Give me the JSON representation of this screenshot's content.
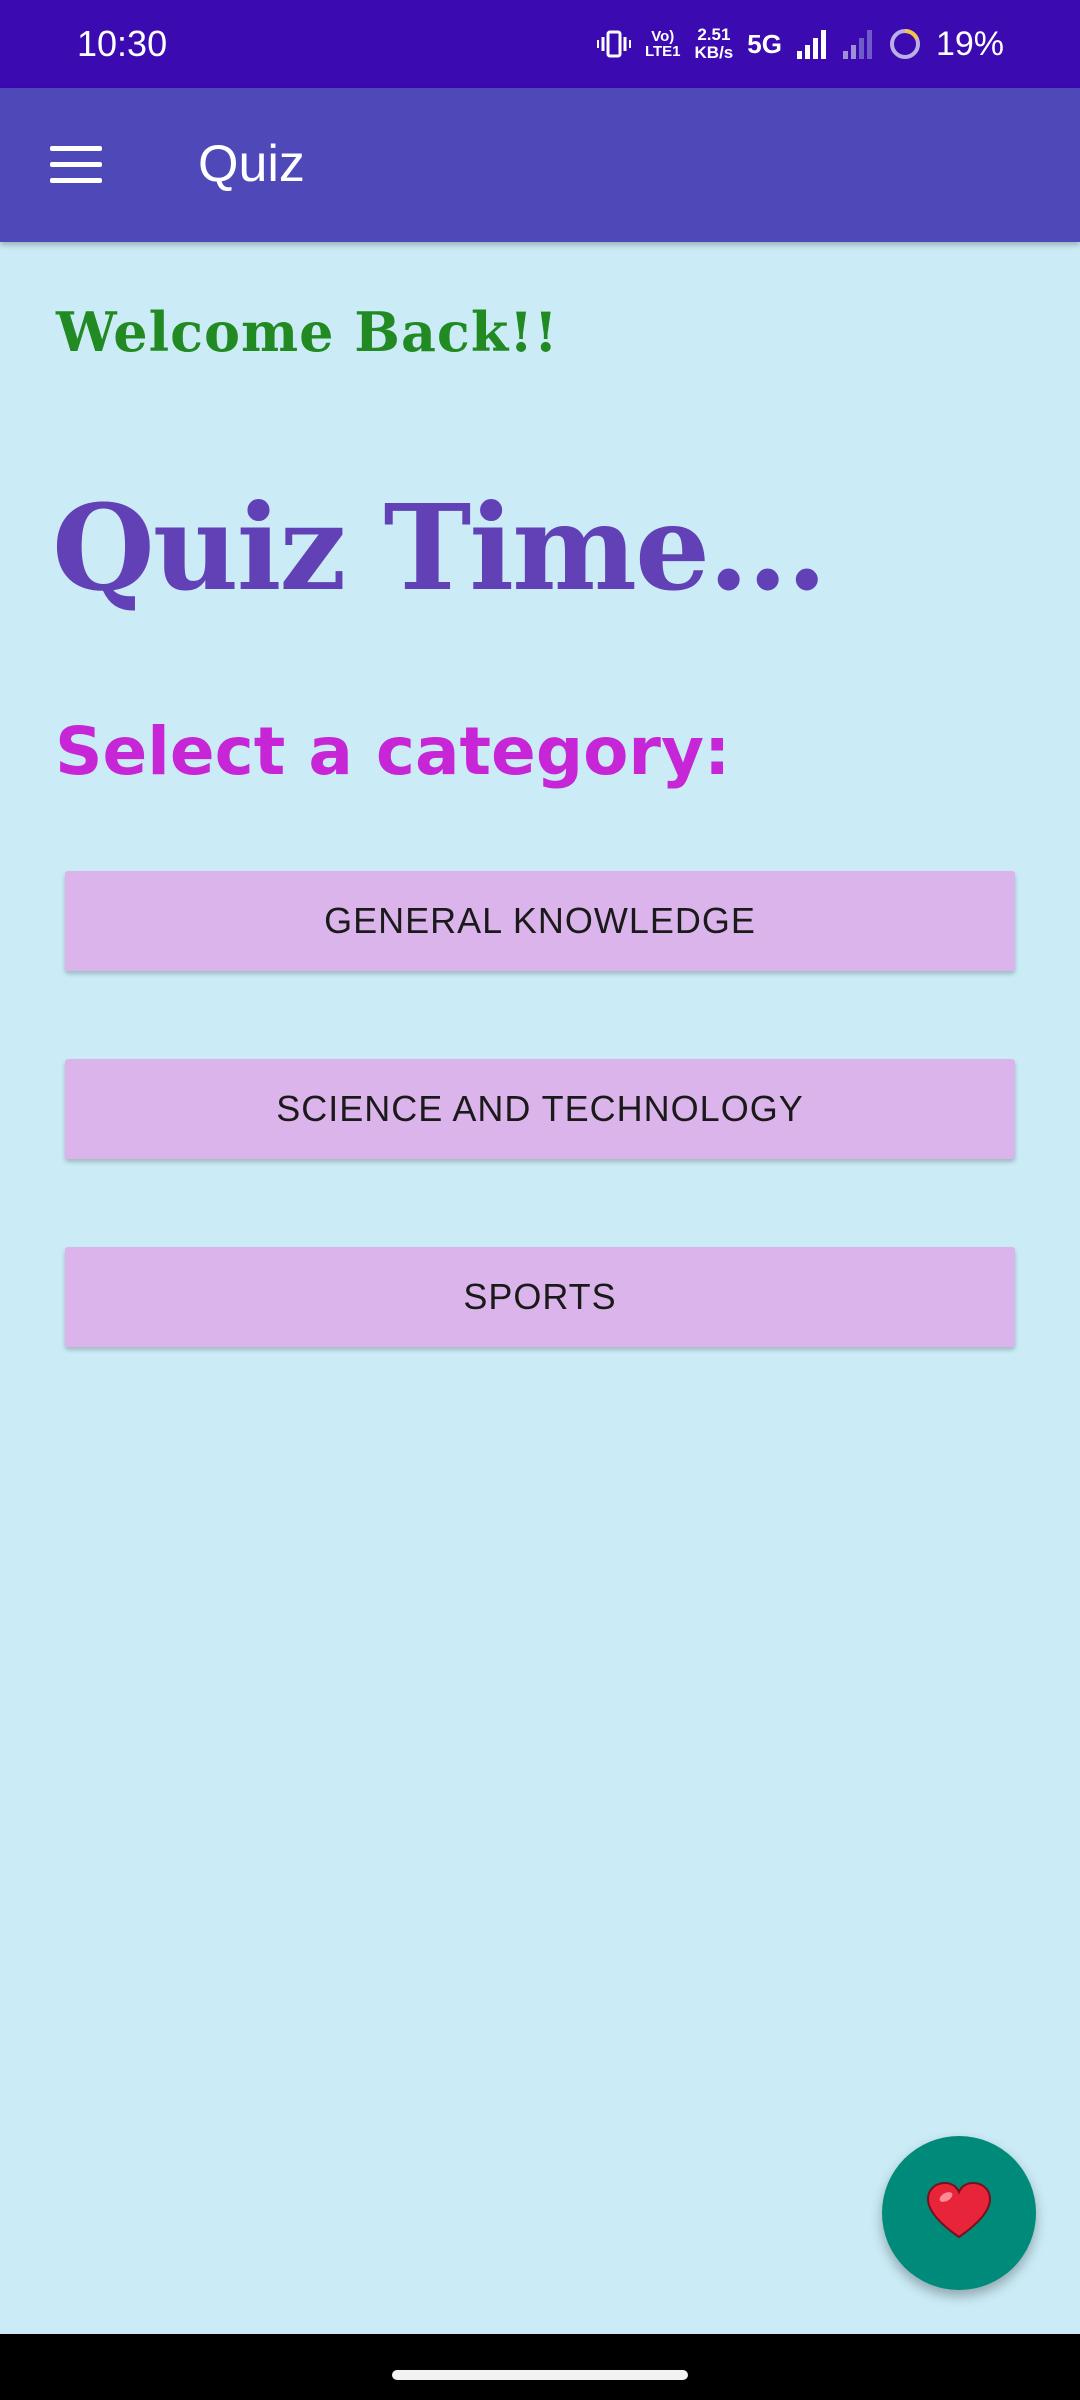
{
  "status_bar": {
    "time": "10:30",
    "volte_top": "Vo)",
    "volte_bottom": "LTE1",
    "speed_value": "2.51",
    "speed_unit": "KB/s",
    "network": "5G",
    "battery": "19%",
    "icons": [
      "vibrate-icon",
      "volte-icon",
      "signal-icon",
      "signal-weak-icon",
      "battery-ring-icon"
    ]
  },
  "app_bar": {
    "title": "Quiz",
    "menu_icon": "hamburger-menu-icon"
  },
  "main": {
    "welcome": "Welcome Back!!",
    "headline": "Quiz Time...",
    "subhead": "Select a category:",
    "categories": [
      {
        "label": "GENERAL KNOWLEDGE"
      },
      {
        "label": "SCIENCE AND TECHNOLOGY"
      },
      {
        "label": "SPORTS"
      }
    ]
  },
  "fab": {
    "icon": "heart-icon"
  },
  "colors": {
    "status_bar": "#3b0ab0",
    "app_bar": "#4f48b8",
    "background": "#cbecf7",
    "welcome": "#218a22",
    "headline": "#6240b6",
    "subhead": "#c626d6",
    "button": "#dcb4ec",
    "fab": "#008a7a"
  }
}
